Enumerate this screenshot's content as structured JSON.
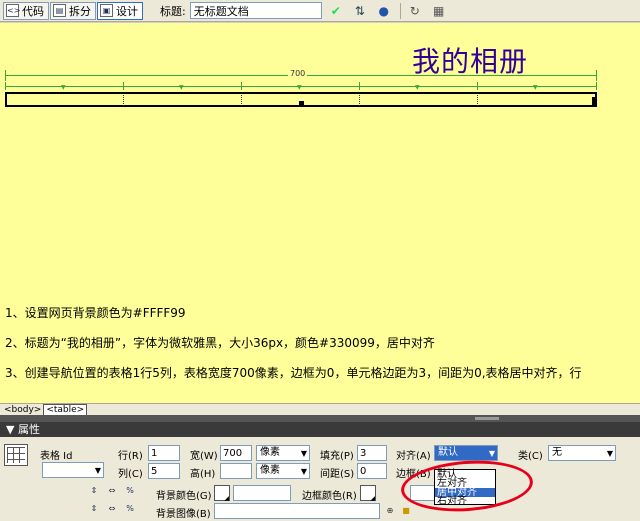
{
  "toolbar": {
    "code_label": "代码",
    "split_label": "拆分",
    "design_label": "设计",
    "title_label": "标题:",
    "title_value": "无标题文档"
  },
  "canvas": {
    "heading": "我的相册",
    "table_width_label": "700",
    "notes": [
      "1、设置网页背景颜色为#FFFF99",
      "2、标题为“我的相册”，字体为微软雅黑，大小36px，颜色#330099，居中对齐",
      "3、创建导航位置的表格1行5列，表格宽度700像素，边框为0，单元格边距为3，间距为0,表格居中对齐，行"
    ]
  },
  "tagbar": {
    "tags": [
      "<body>",
      "<table>"
    ]
  },
  "props": {
    "header": "▼ 属性",
    "table_id_label": "表格 Id",
    "rows_label": "行(R)",
    "rows_value": "1",
    "cols_label": "列(C)",
    "cols_value": "5",
    "width_label": "宽(W)",
    "width_value": "700",
    "height_label": "高(H)",
    "height_value": "",
    "unit1": "像素",
    "unit2": "像素",
    "padding_label": "填充(P)",
    "padding_value": "3",
    "spacing_label": "间距(S)",
    "spacing_value": "0",
    "align_label": "对齐(A)",
    "align_value": "默认",
    "border_label": "边框(B)",
    "class_label": "类(C)",
    "class_value": "无",
    "bgcolor_label": "背景颜色(G)",
    "bordercolor_label": "边框颜色(R)",
    "bgimage_label": "背景图像(B)",
    "align_options": [
      "默认",
      "左对齐",
      "居中对齐",
      "右对齐"
    ]
  },
  "colors": {
    "canvas_bg": "#FFFF99",
    "heading": "#330099",
    "selection": "#316AC5"
  }
}
